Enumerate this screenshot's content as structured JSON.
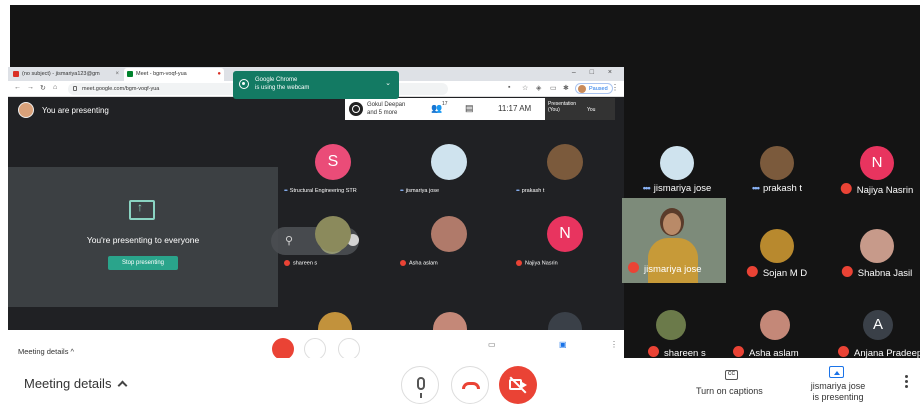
{
  "browser": {
    "tabs": [
      {
        "label": "(no subject) - jismariya123@gm",
        "active": false
      },
      {
        "label": "Meet - bgm-voqf-yua",
        "active": true
      }
    ],
    "url": "meet.google.com/bgm-voqf-yua",
    "paused_label": "Paused"
  },
  "notification": {
    "line1": "Google Chrome",
    "line2": "is using the webcam"
  },
  "presenting": {
    "banner": "You are presenting",
    "message": "You're presenting to everyone",
    "stop_button": "Stop presenting"
  },
  "call_header": {
    "owner_line1": "Gokul Deepan",
    "owner_line2": "and 5 more",
    "participants_count": "17",
    "time": "11:17 AM",
    "thumb_line1": "Presentation",
    "thumb_line2": "(You)",
    "thumb_line3": "You"
  },
  "grid_small": [
    {
      "name": "Structural Engineering STR",
      "avatar": "S",
      "avatar_color": "#ea4c78",
      "status": "speaking"
    },
    {
      "name": "jismariya jose",
      "avatar": "",
      "avatar_color": "#cfe3ee",
      "status": "speaking"
    },
    {
      "name": "prakash t",
      "avatar": "",
      "avatar_color": "#7b5a3c",
      "status": "speaking"
    },
    {
      "name": "shareen s",
      "avatar": "",
      "avatar_color": "#8b8a5c",
      "status": "muted"
    },
    {
      "name": "Asha aslam",
      "avatar": "",
      "avatar_color": "#b07a6a",
      "status": "muted"
    },
    {
      "name": "Najiya Nasrin",
      "avatar": "N",
      "avatar_color": "#e8345f",
      "status": "muted"
    }
  ],
  "grid_large": [
    {
      "name": "jismariya jose",
      "avatar": "",
      "avatar_color": "#cfe3ee",
      "status": "speaking"
    },
    {
      "name": "prakash t",
      "avatar": "",
      "avatar_color": "#7b5a3c",
      "status": "speaking"
    },
    {
      "name": "Najiya Nasrin",
      "avatar": "N",
      "avatar_color": "#e8345f",
      "status": "muted"
    },
    {
      "name": "Sojan M D",
      "avatar": "",
      "avatar_color": "#b8892e",
      "status": "muted"
    },
    {
      "name": "Shabna Jasil",
      "avatar": "",
      "avatar_color": "#c79a8a",
      "status": "muted"
    }
  ],
  "video_tile": {
    "name": "jismariya jose"
  },
  "partial_row": [
    "shareen s",
    "Asha aslam",
    "Anjana Pradeep"
  ],
  "partial_row_avatar": "A",
  "controls": {
    "meeting_details": "Meeting details",
    "captions": "Turn on captions",
    "captions_icon": "CC",
    "presenter_line1": "jismariya jose",
    "presenter_line2": "is presenting"
  }
}
